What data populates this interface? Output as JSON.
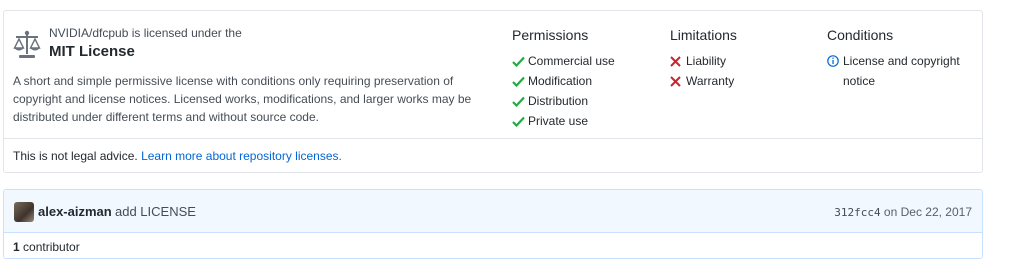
{
  "license": {
    "subtitle": "NVIDIA/dfcpub is licensed under the",
    "name": "MIT License",
    "description": "A short and simple permissive license with conditions only requiring preservation of copyright and license notices. Licensed works, modifications, and larger works may be distributed under different terms and without source code.",
    "icon": "law-scale-icon",
    "permissions": {
      "title": "Permissions",
      "items": [
        "Commercial use",
        "Modification",
        "Distribution",
        "Private use"
      ]
    },
    "limitations": {
      "title": "Limitations",
      "items": [
        "Liability",
        "Warranty"
      ]
    },
    "conditions": {
      "title": "Conditions",
      "items": [
        "License and copyright notice"
      ]
    },
    "footer": {
      "text": "This is not legal advice.",
      "link": "Learn more about repository licenses."
    }
  },
  "commit": {
    "author": "alex-aizman",
    "message": "add LICENSE",
    "sha": "312fcc4",
    "date": "on Dec 22, 2017"
  },
  "contributors": {
    "count": "1",
    "label": "contributor"
  },
  "colors": {
    "check": "#28a745",
    "cross": "#cb2431",
    "info": "#0366d6",
    "link": "#0366d6"
  }
}
